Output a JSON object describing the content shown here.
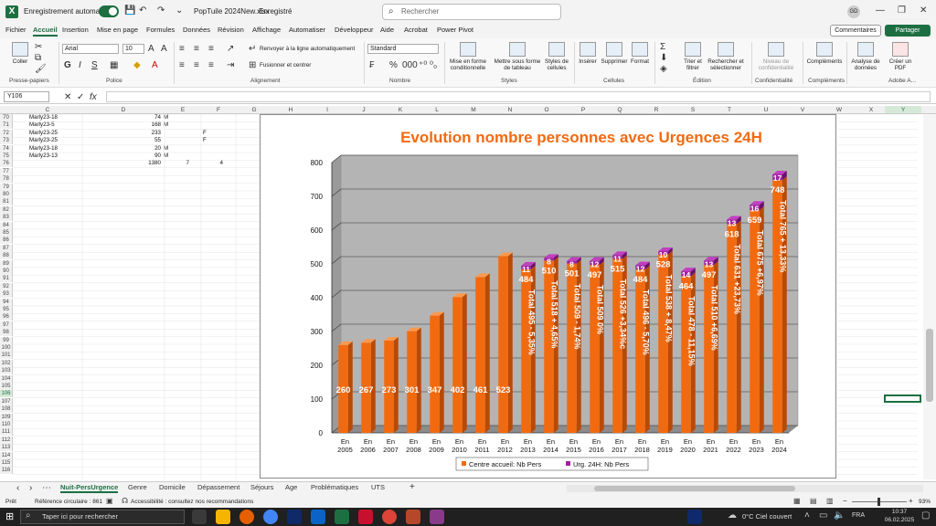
{
  "titlebar": {
    "autosave_label": "Enregistrement automatique",
    "filename": "PopTuile 2024New.xlsx",
    "saved_status": "Enregistré",
    "search_placeholder": "Rechercher",
    "user_initials": "GD"
  },
  "menu": {
    "items": [
      "Fichier",
      "Accueil",
      "Insertion",
      "Mise en page",
      "Formules",
      "Données",
      "Révision",
      "Affichage",
      "Automatiser",
      "Développeur",
      "Aide",
      "Acrobat",
      "Power Pivot"
    ],
    "active": "Accueil",
    "comments_label": "Commentaires",
    "share_label": "Partager"
  },
  "ribbon": {
    "paste_label": "Coller",
    "font_name": "Arial",
    "font_size": "10",
    "wrap_label": "Renvoyer à la ligne automatiquement",
    "merge_label": "Fusionner et centrer",
    "number_format": "Standard",
    "conditional_label": "Mise en forme conditionnelle",
    "table_label": "Mettre sous forme de tableau",
    "cellstyles_label": "Styles de cellules",
    "insert_label": "Insérer",
    "delete_label": "Supprimer",
    "format_label": "Format",
    "sort_label": "Trier et filtrer",
    "find_label": "Rechercher et sélectionner",
    "sensitivity_label": "Niveau de confidentialité",
    "addins_label": "Compléments",
    "analyze_label": "Analyse de données",
    "pdf_label": "Créer un PDF",
    "groups": {
      "clipboard": "Presse-papiers",
      "font": "Police",
      "alignment": "Alignement",
      "number": "Nombre",
      "styles": "Styles",
      "cells": "Cellules",
      "editing": "Édition",
      "confidentiality": "Confidentialité",
      "addins": "Compléments",
      "adobe": "Adobe A..."
    }
  },
  "formula": {
    "namebox": "Y106",
    "fx": "fx"
  },
  "sheet": {
    "columns": [
      "C",
      "D",
      "E",
      "F",
      "G",
      "H",
      "I",
      "J",
      "K",
      "L",
      "M",
      "N",
      "O",
      "P",
      "Q",
      "R",
      "S",
      "T",
      "U",
      "V",
      "W",
      "X",
      "Y"
    ],
    "row_numbers": [
      "70",
      "71",
      "72",
      "73",
      "74",
      "75",
      "76",
      "77",
      "78",
      "79",
      "80",
      "81",
      "82",
      "83",
      "84",
      "85",
      "86",
      "87",
      "88",
      "89",
      "90",
      "91",
      "92",
      "93",
      "94",
      "95",
      "96",
      "97",
      "98",
      "99",
      "100",
      "101",
      "102",
      "103",
      "104",
      "105",
      "106",
      "107",
      "108",
      "109",
      "110",
      "111",
      "112",
      "113",
      "114",
      "115",
      "116"
    ],
    "rows": [
      {
        "c": "Marly23-18",
        "d": "74",
        "e": "M",
        "f": ""
      },
      {
        "c": "Marly23-5",
        "d": "168",
        "e": "M",
        "f": ""
      },
      {
        "c": "Marly23-25",
        "d": "233",
        "e": "",
        "f": "F"
      },
      {
        "c": "Marly23-25",
        "d": "55",
        "e": "",
        "f": "F"
      },
      {
        "c": "Marly23-18",
        "d": "20",
        "e": "M",
        "f": ""
      },
      {
        "c": "Marly23-13",
        "d": "90",
        "e": "M",
        "f": ""
      },
      {
        "c": "",
        "d": "1380",
        "e": "7",
        "f": "4"
      }
    ]
  },
  "chart_data": {
    "type": "bar",
    "title": "Evolution nombre personnes avec Urgences 24H",
    "categories": [
      "En 2005",
      "En 2006",
      "En 2007",
      "En 2008",
      "En 2009",
      "En 2010",
      "En 2011",
      "En 2012",
      "En 2013",
      "En 2014",
      "En 2015",
      "En 2016",
      "En 2017",
      "En 2018",
      "En 2019",
      "En 2020",
      "En 2021",
      "En 2022",
      "En 2023",
      "En 2024"
    ],
    "series": [
      {
        "name": "Centre accueil: Nb Pers",
        "values": [
          260,
          267,
          273,
          301,
          347,
          402,
          461,
          523,
          484,
          510,
          501,
          497,
          515,
          484,
          528,
          464,
          497,
          618,
          659,
          748
        ],
        "color": "#f26a10"
      },
      {
        "name": "Urg. 24H: Nb Pers",
        "values": [
          0,
          0,
          0,
          0,
          0,
          0,
          0,
          0,
          11,
          8,
          8,
          12,
          11,
          12,
          10,
          14,
          13,
          13,
          16,
          17
        ],
        "color": "#a020a0"
      }
    ],
    "totals": [
      "",
      "",
      "",
      "",
      "",
      "",
      "",
      "",
      "Total 495 - 5,35%",
      "Total 518 + 4,65%",
      "Total 509 - 1,74%",
      "Total 509 0%",
      "Total 526 +3,34%c",
      "Total 496 - 5,70%",
      "Total 538 + 8,47%",
      "Total 478 - 11,15%",
      "Total 510 +6,69%",
      "Total 631 +23,73%",
      "Total 675 +6,97%",
      "Total 765 + 13,33%"
    ],
    "y_ticks": [
      0,
      100,
      200,
      300,
      400,
      500,
      600,
      700,
      800
    ],
    "ylim": [
      0,
      800
    ],
    "legend": "bottom",
    "grid": true
  },
  "tabs": {
    "items": [
      "Nuit-PersUrgence",
      "Genre",
      "Domicile",
      "Dépassement",
      "Séjours",
      "Age",
      "Problématiques",
      "UTS"
    ],
    "active": "Nuit-PersUrgence"
  },
  "status": {
    "ready": "Prêt",
    "circular": "Référence circulaire : 861",
    "accessibility": "Accessibilité : consultez nos recommandations",
    "zoom": "93%"
  },
  "taskbar": {
    "search_placeholder": "Taper ici pour rechercher",
    "weather": "0°C Ciel couvert",
    "lang": "FRA",
    "time": "10:37",
    "date": "06.02.2025"
  }
}
